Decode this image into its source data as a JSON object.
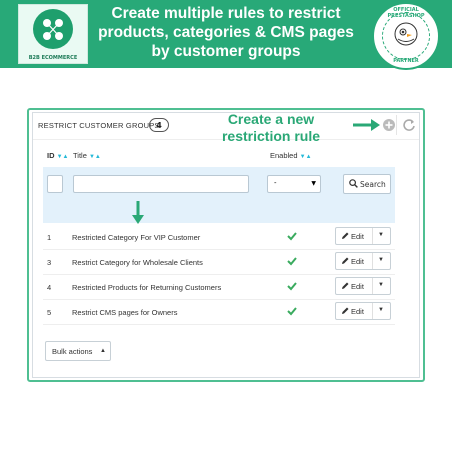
{
  "banner": {
    "headline_lines": [
      "Create multiple rules to restrict",
      "products, categories & CMS pages",
      "by customer groups"
    ],
    "logo_caption": "B2B ECOMMERCE",
    "badge_top": "OFFICIAL PRESTASHOP",
    "badge_bottom": "PARTNER",
    "brand_color": "#28a978"
  },
  "panel": {
    "title": "RESTRICT CUSTOMER GROUPS",
    "count": "4",
    "annotation": "Create a new restriction rule",
    "add_icon": "add-circle-icon",
    "refresh_icon": "refresh-icon"
  },
  "table": {
    "columns": {
      "id": "ID",
      "title": "Title",
      "enabled": "Enabled"
    },
    "filter": {
      "id_value": "",
      "title_value": "",
      "enabled_value": "-",
      "search_label": "Search"
    },
    "rows": [
      {
        "id": "1",
        "title": "Restricted Category For VIP Customer",
        "enabled": true,
        "action": "Edit"
      },
      {
        "id": "3",
        "title": "Restrict Category for Wholesale Clients",
        "enabled": true,
        "action": "Edit"
      },
      {
        "id": "4",
        "title": "Restricted Products for Returning Customers",
        "enabled": true,
        "action": "Edit"
      },
      {
        "id": "5",
        "title": "Restrict CMS pages for Owners",
        "enabled": true,
        "action": "Edit"
      }
    ],
    "bulk_label": "Bulk actions"
  },
  "colors": {
    "accent": "#25b9d7",
    "check": "#3aab5f",
    "annotation": "#2aa876"
  }
}
